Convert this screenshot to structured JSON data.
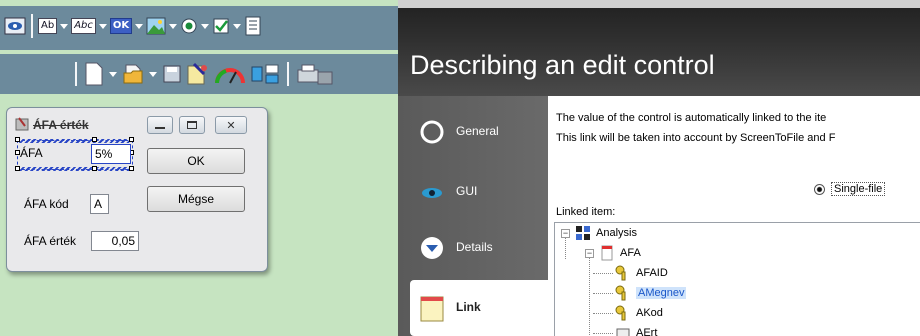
{
  "toolbar_top": {
    "items": [
      {
        "icon": "eye-icon"
      },
      {
        "icon": "label-control-icon",
        "chip": "Ab"
      },
      {
        "icon": "italic-text-control-icon",
        "chip": "Abc"
      },
      {
        "icon": "button-control-icon",
        "chip": "OK"
      },
      {
        "icon": "image-control-icon"
      },
      {
        "icon": "radio-control-icon"
      },
      {
        "icon": "checkbox-control-icon"
      },
      {
        "icon": "listbox-control-icon"
      }
    ]
  },
  "toolbar_bottom": {
    "items": [
      "new-document-icon",
      "open-folder-icon",
      "save-disk-icon",
      "wizard-icon",
      "gauge-icon",
      "layout-icon",
      "print-icon"
    ]
  },
  "dialog": {
    "title": "ÁFA érték",
    "rows": [
      {
        "label": "ÁFA",
        "value": "5%"
      },
      {
        "label": "ÁFA kód",
        "value": "A"
      },
      {
        "label": "ÁFA érték",
        "value": "0,05"
      }
    ],
    "ok_label": "OK",
    "cancel_label": "Mégse"
  },
  "wizard": {
    "title": "Describing an edit control",
    "nav": [
      {
        "label": "General",
        "icon": "circle-icon"
      },
      {
        "label": "GUI",
        "icon": "eye-icon"
      },
      {
        "label": "Details",
        "icon": "chevron-down-circle-icon"
      },
      {
        "label": "Link",
        "icon": "note-icon",
        "active": true
      }
    ],
    "desc_line1": "The value of the control is automatically linked to the ite",
    "desc_line2": "This link will be taken into account by ScreenToFile and F",
    "single_file_label": "Single-file",
    "linked_label": "Linked item:",
    "tree": [
      {
        "label": "Analysis",
        "level": 0,
        "icon": "analysis-icon"
      },
      {
        "label": "AFA",
        "level": 1,
        "icon": "file-icon"
      },
      {
        "label": "AFAID",
        "level": 2,
        "icon": "key-icon"
      },
      {
        "label": "AMegnev",
        "level": 2,
        "icon": "key-icon",
        "selected": true
      },
      {
        "label": "AKod",
        "level": 2,
        "icon": "key-icon"
      },
      {
        "label": "AErt",
        "level": 2,
        "icon": "field-icon"
      }
    ]
  },
  "colors": {
    "editor_bg": "#c6e4c1",
    "toolbar_bg": "#6c8a9c",
    "wizard_header": "#2f2f2f",
    "selection_blue": "#2946c6",
    "tree_highlight": "#1a57c9"
  }
}
